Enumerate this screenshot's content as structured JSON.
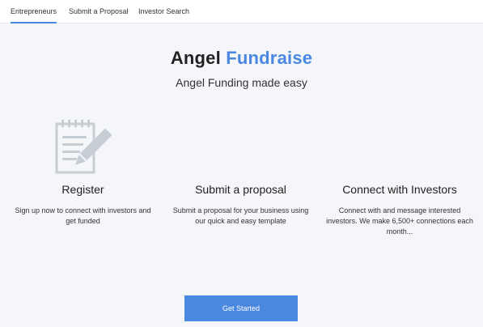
{
  "nav": {
    "tabs": [
      "Entrepreneurs",
      "Submit a Proposal",
      "Investor Search"
    ],
    "active_tab": "Entrepreneurs"
  },
  "hero": {
    "title_main": "Angel",
    "title_accent": "Fundraise",
    "subtitle": "Angel Funding made easy"
  },
  "features": [
    {
      "title": "Register",
      "text": "Sign up now to connect with investors and get funded"
    },
    {
      "title": "Submit a proposal",
      "text": "Submit a proposal for your business using our quick and easy template"
    },
    {
      "title": "Connect with Investors",
      "text": "Connect with and message interested investors. We make 6,500+ connections each month..."
    }
  ],
  "cta": {
    "label": "Get Started"
  },
  "icons": {
    "register": "document-pencil-icon"
  },
  "colors": {
    "accent": "#4a87e0",
    "background": "#f4f6f9",
    "icon": "#c7cdd5"
  }
}
